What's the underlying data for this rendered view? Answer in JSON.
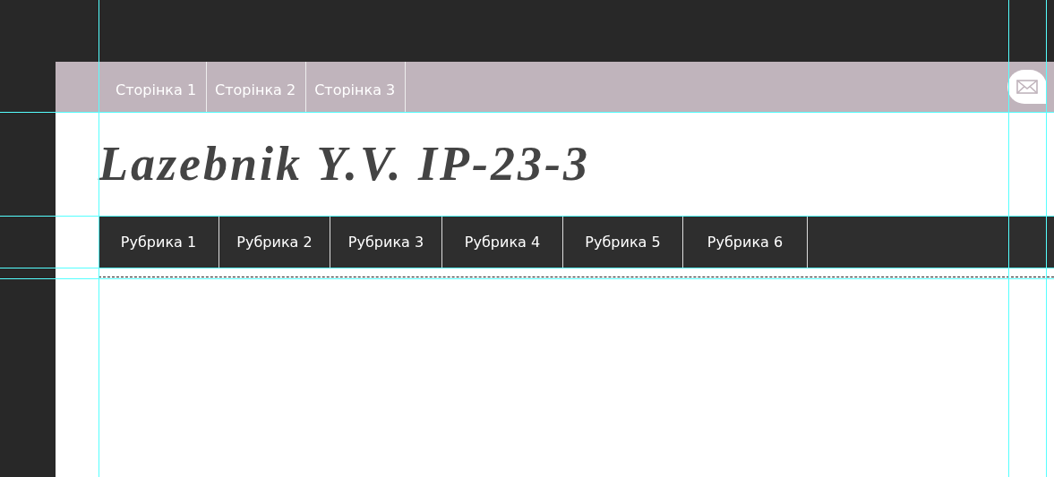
{
  "top_menu": [
    {
      "label": "Сторінка 1"
    },
    {
      "label": "Сторінка 2"
    },
    {
      "label": "Сторінка 3"
    }
  ],
  "site_title": "Lazebnik Y.V. IP-23-3",
  "categories": [
    {
      "label": "Рубрика 1"
    },
    {
      "label": "Рубрика 2"
    },
    {
      "label": "Рубрика 3"
    },
    {
      "label": "Рубрика 4"
    },
    {
      "label": "Рубрика 5"
    },
    {
      "label": "Рубрика 6"
    }
  ]
}
